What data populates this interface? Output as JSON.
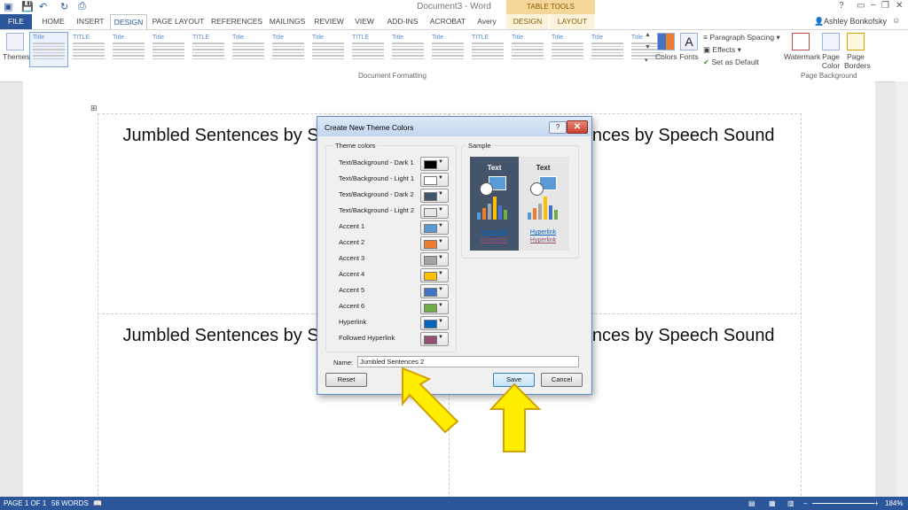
{
  "window": {
    "title": "Document3 - Word",
    "contextual_header": "TABLE TOOLS",
    "user": "Ashley Bonkofsky"
  },
  "tabs": [
    "FILE",
    "HOME",
    "INSERT",
    "DESIGN",
    "PAGE LAYOUT",
    "REFERENCES",
    "MAILINGS",
    "REVIEW",
    "VIEW",
    "ADD-INS",
    "ACROBAT",
    "Avery",
    "DESIGN",
    "LAYOUT"
  ],
  "ribbon": {
    "themes_label": "Themes",
    "gallery_titles": [
      "Title",
      "TITLE",
      "Title",
      "Title",
      "TITLE",
      "Title",
      "Title",
      "Title",
      "TITLE",
      "Title",
      "Title",
      "TITLE",
      "Title",
      "Title",
      "Title",
      "Title"
    ],
    "colors_label": "Colors",
    "fonts_label": "Fonts",
    "paragraph_spacing": "Paragraph Spacing",
    "effects": "Effects",
    "set_as_default": "Set as Default",
    "group_document_formatting": "Document Formatting",
    "watermark": "Watermark",
    "page_color": "Page Color",
    "page_borders": "Page Borders",
    "group_page_background": "Page Background"
  },
  "document": {
    "cells": [
      "Jumbled Sentences by Speech Sound",
      "Jumbled Sentences by Speech Sound",
      "Jumbled Sentences by Speech Sound",
      "Jumbled Sentences by Speech Sound"
    ]
  },
  "dialog": {
    "title": "Create New Theme Colors",
    "help": "?",
    "close": "✕",
    "theme_colors_legend": "Theme colors",
    "sample_legend": "Sample",
    "colors": [
      {
        "label": "Text/Background - Dark 1",
        "color": "#000000"
      },
      {
        "label": "Text/Background - Light 1",
        "color": "#ffffff"
      },
      {
        "label": "Text/Background - Dark 2",
        "color": "#44546a"
      },
      {
        "label": "Text/Background - Light 2",
        "color": "#e7e6e6"
      },
      {
        "label": "Accent 1",
        "color": "#5b9bd5"
      },
      {
        "label": "Accent 2",
        "color": "#ed7d31"
      },
      {
        "label": "Accent 3",
        "color": "#a5a5a5"
      },
      {
        "label": "Accent 4",
        "color": "#ffc000"
      },
      {
        "label": "Accent 5",
        "color": "#4472c4"
      },
      {
        "label": "Accent 6",
        "color": "#70ad47"
      },
      {
        "label": "Hyperlink",
        "color": "#0563c1"
      },
      {
        "label": "Followed Hyperlink",
        "color": "#954f72"
      }
    ],
    "sample_text": "Text",
    "sample_hyperlink": "Hyperlink",
    "name_label": "Name:",
    "name_value": "Jumbled Sentences 2",
    "reset": "Reset",
    "save": "Save",
    "cancel": "Cancel"
  },
  "status": {
    "page": "PAGE 1 OF 1",
    "words": "58 WORDS",
    "zoom": "184%"
  }
}
